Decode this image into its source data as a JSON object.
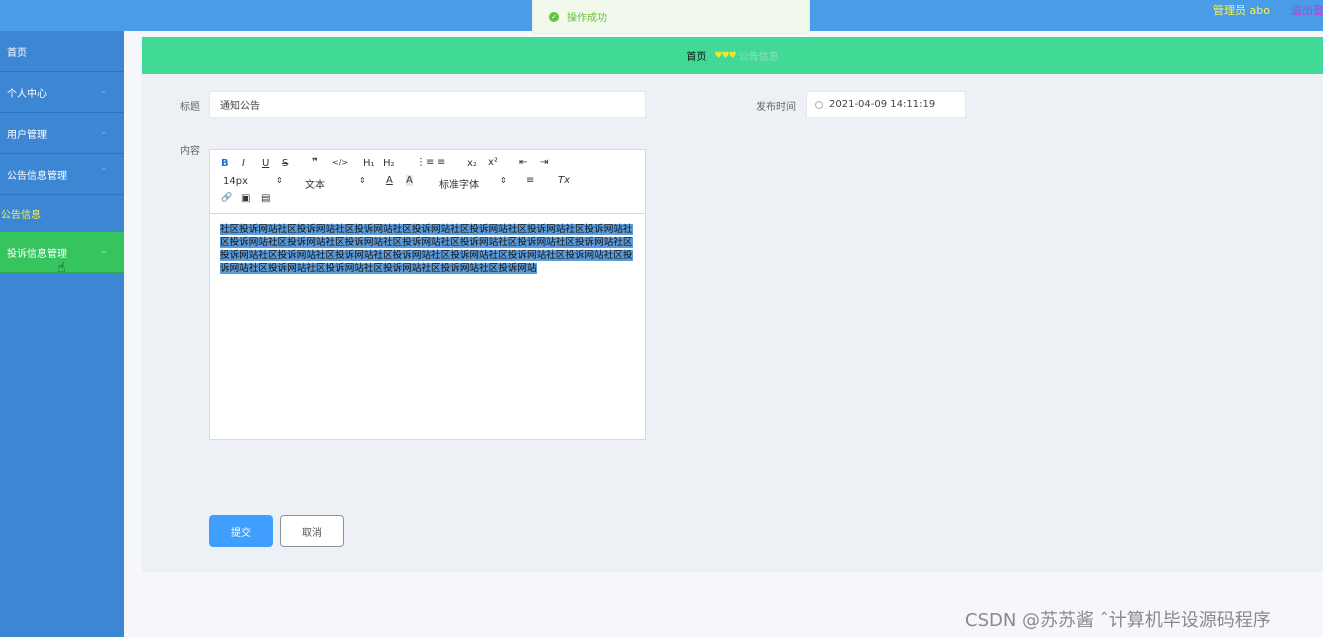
{
  "header": {
    "user_label": "管理员 abo",
    "logout_label": "退出登录"
  },
  "toast": {
    "message": "操作成功"
  },
  "sidebar": {
    "items": [
      {
        "label": "首页"
      },
      {
        "label": "个人中心"
      },
      {
        "label": "用户管理"
      },
      {
        "label": "公告信息管理"
      },
      {
        "label": "公告信息"
      },
      {
        "label": "投诉信息管理"
      }
    ]
  },
  "breadcrumb": {
    "home": "首页",
    "current": "公告信息"
  },
  "form": {
    "title_label": "标题",
    "title_value": "通知公告",
    "publish_time_label": "发布时间",
    "publish_time_value": "2021-04-09 14:11:19",
    "content_label": "内容",
    "content_value": "社区投诉网站社区投诉网站社区投诉网站社区投诉网站社区投诉网站社区投诉网站社区投诉网站社区投诉网站社区投诉网站社区投诉网站社区投诉网站社区投诉网站社区投诉网站社区投诉网站社区投诉网站社区投诉网站社区投诉网站社区投诉网站社区投诉网站社区投诉网站社区投诉网站社区投诉网站社区投诉网站社区投诉网站社区投诉网站社区投诉网站社区投诉网站"
  },
  "editor_toolbar": {
    "bold": "B",
    "italic": "I",
    "underline": "U",
    "strike": "S",
    "blockquote": "❞",
    "code": "</>",
    "h1": "H₁",
    "h2": "H₂",
    "ordered_list": "⋮≡",
    "bullet_list": "≡",
    "subscript": "x₂",
    "superscript": "x²",
    "outdent": "⇤",
    "indent": "⇥",
    "size": "14px",
    "header_select": "文本",
    "font_color": "A",
    "bg_color": "A",
    "font_family": "标准字体",
    "align": "≡",
    "clean": "Tx",
    "link": "🔗",
    "image": "▣",
    "video": "▤"
  },
  "buttons": {
    "submit": "提交",
    "cancel": "取消"
  },
  "watermark": "CSDN @苏苏酱    ˆ计算机毕设源码程序"
}
